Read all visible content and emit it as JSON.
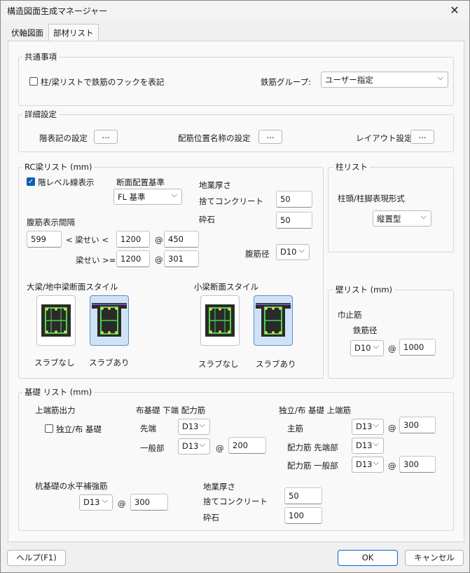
{
  "window": {
    "title": "構造図面生成マネージャー",
    "close": "✕"
  },
  "tabs": [
    {
      "label": "伏軸図面"
    },
    {
      "label": "部材リスト"
    }
  ],
  "common": {
    "title": "共通事項",
    "hook_label": "柱/梁リストで鉄筋のフックを表記",
    "group_label": "鉄筋グループ:",
    "group_value": "ユーザー指定"
  },
  "detail": {
    "title": "詳細設定",
    "floor_label": "階表記の設定",
    "pos_label": "配筋位置名称の設定",
    "layout_label": "レイアウト設定",
    "dots": "..."
  },
  "rc": {
    "title": "RC梁リスト (mm)",
    "level_line": "階レベル線表示",
    "section_ref": "断面配置基準",
    "section_ref_value": "FL 基準",
    "ground_title": "地業厚さ",
    "sute": "捨てコンクリート",
    "sute_value": "50",
    "saiseki": "砕石",
    "saiseki_value": "50",
    "web_interval": "腹筋表示間隔",
    "v599": "599",
    "lt": "< 梁せい <",
    "v1200a": "1200",
    "v450": "450",
    "ge": "梁せい >=",
    "v1200b": "1200",
    "v301": "301",
    "web_dia": "腹筋径",
    "web_dia_value": "D10",
    "at": "@",
    "big_style": "大梁/地中梁断面スタイル",
    "small_style": "小梁断面スタイル",
    "slab_none": "スラブなし",
    "slab_yes": "スラブあり"
  },
  "col": {
    "title": "柱リスト",
    "style_label": "柱頭/柱脚表現形式",
    "style_value": "縦置型"
  },
  "wall": {
    "title": "壁リスト (mm)",
    "stop": "巾止筋",
    "dia": "鉄筋径",
    "dia_value": "D10",
    "pitch": "1000"
  },
  "found": {
    "title": "基礎 リスト (mm)",
    "top_out": "上端筋出力",
    "indep": "独立/布 基礎",
    "strip_bottom": "布基礎 下端 配力筋",
    "tip": "先端",
    "tip_value": "D13",
    "general": "一般部",
    "general_value": "D13",
    "general_pitch": "200",
    "indep_top": "独立/布 基礎 上端筋",
    "main": "主筋",
    "main_value": "D13",
    "main_pitch": "300",
    "dist_tip": "配力筋 先端部",
    "dist_tip_value": "D13",
    "dist_gen": "配力筋 一般部",
    "dist_gen_value": "D13",
    "dist_gen_pitch": "300",
    "pile": "杭基礎の水平補強筋",
    "pile_value": "D13",
    "pile_pitch": "300",
    "ground": "地業厚さ",
    "sute": "捨てコンクリート",
    "sute_value": "50",
    "saiseki": "砕石",
    "saiseki_value": "100"
  },
  "footer": {
    "help": "ヘルプ(F1)",
    "ok": "OK",
    "cancel": "キャンセル"
  },
  "chevron": "⌵"
}
